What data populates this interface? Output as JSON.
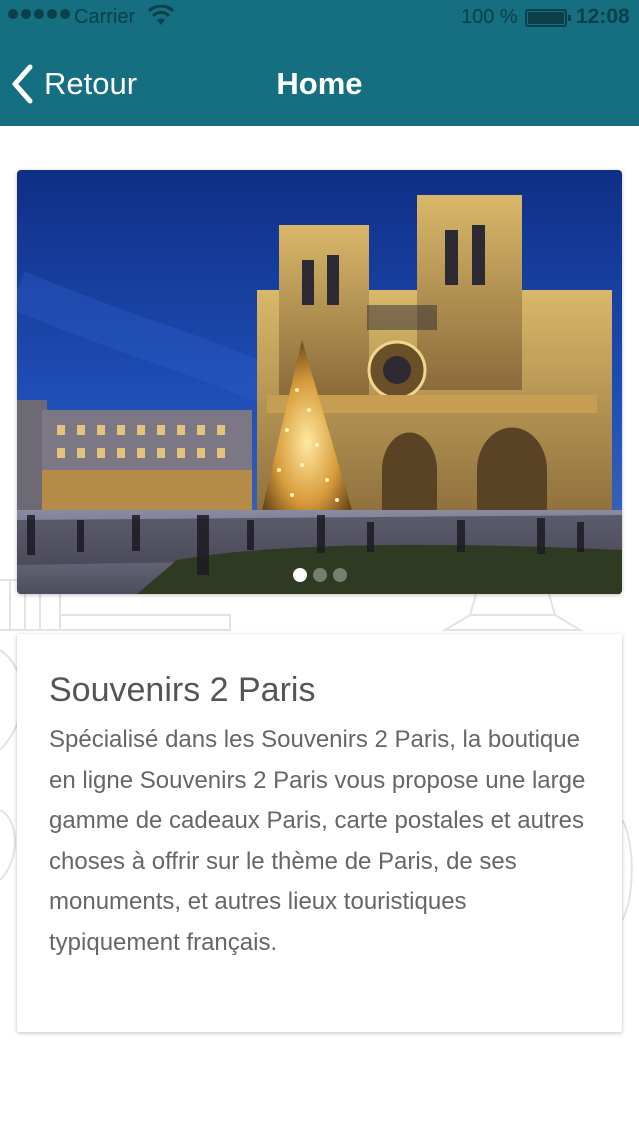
{
  "status_bar": {
    "carrier": "Carrier",
    "battery": "100 %",
    "time": "12:08"
  },
  "nav": {
    "back_label": "Retour",
    "title": "Home"
  },
  "carousel": {
    "slides": 3,
    "active_index": 0,
    "image_subject": "Notre-Dame de Paris at night"
  },
  "card": {
    "title": "Souvenirs 2 Paris",
    "description": "Spécialisé dans les Souvenirs 2 Paris, la boutique en ligne Souvenirs 2 Paris vous propose une large gamme de cadeaux Paris, carte postales et autres choses à offrir sur le thème de Paris, de ses monuments, et autres lieux touristiques typiquement français."
  },
  "colors": {
    "nav_bar": "#156f80",
    "status_text": "#0b3f4a",
    "card_text": "#666666"
  }
}
